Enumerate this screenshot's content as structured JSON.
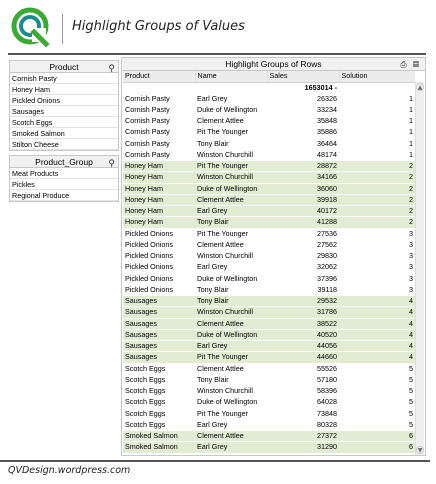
{
  "header": {
    "title": "Highlight Groups of Values"
  },
  "product_listbox": {
    "title": "Product",
    "items": [
      "Cornish Pasty",
      "Honey Ham",
      "Pickled Onions",
      "Sausages",
      "Scotch Eggs",
      "Smoked Salmon",
      "Stilton Cheese"
    ]
  },
  "group_listbox": {
    "title": "Product_Group",
    "items": [
      "Meat Products",
      "Pickles",
      "Regional Produce"
    ]
  },
  "table": {
    "caption": "Highlight Groups of Rows",
    "columns": [
      "Product",
      "Name",
      "Sales",
      "Solution"
    ],
    "total_sales": "1653014 -",
    "rows": [
      [
        "Cornish Pasty",
        "Earl Grey",
        "26326",
        "1"
      ],
      [
        "Cornish Pasty",
        "Duke of Wellington",
        "33234",
        "1"
      ],
      [
        "Cornish Pasty",
        "Clement Attlee",
        "35848",
        "1"
      ],
      [
        "Cornish Pasty",
        "Pit The Younger",
        "35886",
        "1"
      ],
      [
        "Cornish Pasty",
        "Tony Blair",
        "36464",
        "1"
      ],
      [
        "Cornish Pasty",
        "Winston Churchill",
        "48174",
        "1"
      ],
      [
        "Honey Ham",
        "Pit The Younger",
        "28872",
        "2"
      ],
      [
        "Honey Ham",
        "Winston Churchill",
        "34166",
        "2"
      ],
      [
        "Honey Ham",
        "Duke of Wellington",
        "36060",
        "2"
      ],
      [
        "Honey Ham",
        "Clement Attlee",
        "39918",
        "2"
      ],
      [
        "Honey Ham",
        "Earl Grey",
        "40172",
        "2"
      ],
      [
        "Honey Ham",
        "Tony Blair",
        "41288",
        "2"
      ],
      [
        "Pickled Onions",
        "Pit The Younger",
        "27536",
        "3"
      ],
      [
        "Pickled Onions",
        "Clement Attlee",
        "27562",
        "3"
      ],
      [
        "Pickled Onions",
        "Winston Churchill",
        "29830",
        "3"
      ],
      [
        "Pickled Onions",
        "Earl Grey",
        "32062",
        "3"
      ],
      [
        "Pickled Onions",
        "Duke of Wellington",
        "37396",
        "3"
      ],
      [
        "Pickled Onions",
        "Tony Blair",
        "39118",
        "3"
      ],
      [
        "Sausages",
        "Tony Blair",
        "29532",
        "4"
      ],
      [
        "Sausages",
        "Winston Churchill",
        "31786",
        "4"
      ],
      [
        "Sausages",
        "Clement Attlee",
        "38522",
        "4"
      ],
      [
        "Sausages",
        "Duke of Wellington",
        "40520",
        "4"
      ],
      [
        "Sausages",
        "Earl Grey",
        "44056",
        "4"
      ],
      [
        "Sausages",
        "Pit The Younger",
        "44660",
        "4"
      ],
      [
        "Scotch Eggs",
        "Clement Attlee",
        "55526",
        "5"
      ],
      [
        "Scotch Eggs",
        "Tony Blair",
        "57180",
        "5"
      ],
      [
        "Scotch Eggs",
        "Winston Churchill",
        "58396",
        "5"
      ],
      [
        "Scotch Eggs",
        "Duke of Wellington",
        "64028",
        "5"
      ],
      [
        "Scotch Eggs",
        "Pit The Younger",
        "73848",
        "5"
      ],
      [
        "Scotch Eggs",
        "Earl Grey",
        "80328",
        "5"
      ],
      [
        "Smoked Salmon",
        "Clement Attlee",
        "27372",
        "6"
      ],
      [
        "Smoked Salmon",
        "Earl Grey",
        "31290",
        "6"
      ]
    ]
  },
  "footer": {
    "text": "QVDesign.wordpress.com"
  },
  "colors": {
    "shaded_row": "#e1ecd3",
    "logo_green": "#3aaa35",
    "logo_teal": "#1a8a8a"
  }
}
